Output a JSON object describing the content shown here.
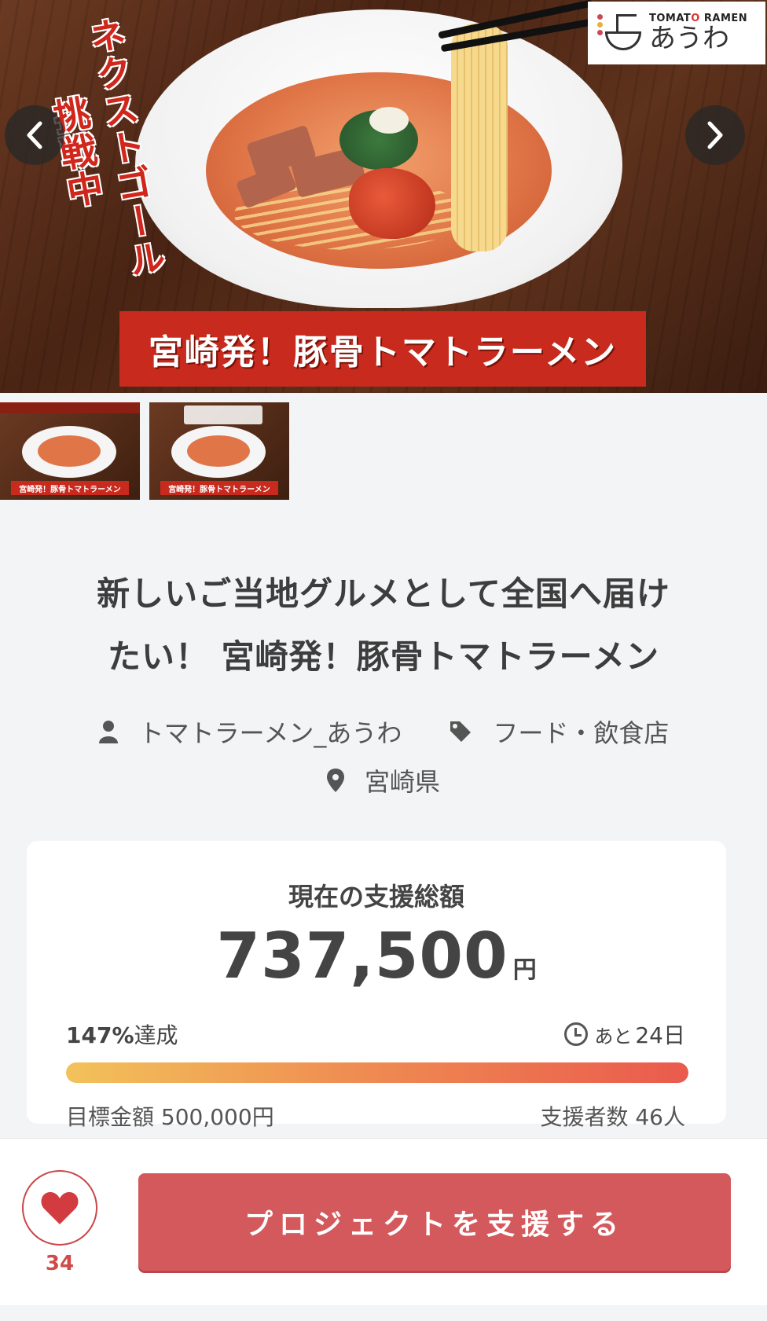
{
  "hero": {
    "vertical_text_1": "ネクストゴール",
    "vertical_text_2": "挑戦中",
    "banner_text": "宮崎発！豚骨トマトラーメン",
    "logo_en_prefix": "TOMAT",
    "logo_en_o": "O",
    "logo_en_suffix": " RAMEN",
    "logo_jp": "あうわ",
    "prev_icon": "chevron-left-icon",
    "next_icon": "chevron-right-icon"
  },
  "thumbnails": [
    {
      "banner": "宮崎発！豚骨トマトラーメン"
    },
    {
      "banner": "宮崎発！豚骨トマトラーメン"
    }
  ],
  "project": {
    "title_line1": "新しいご当地グルメとして全国へ届け",
    "title_line2": "たい！ 宮崎発！豚骨トマトラーメン",
    "owner": "トマトラーメン_あうわ",
    "category": "フード・飲食店",
    "location": "宮崎県"
  },
  "funding": {
    "label": "現在の支援総額",
    "amount": "737,500",
    "unit": "円",
    "achievement_percent": "147%",
    "achievement_suffix": "達成",
    "progress_fraction": 1.0,
    "remaining_prefix": "あと",
    "remaining_days": "24日",
    "goal_label": "目標金額 500,000円",
    "backers_label": "支援者数 46人"
  },
  "actions": {
    "like_count": "34",
    "support_button": "プロジェクトを支援する"
  },
  "colors": {
    "accent": "#d4595d",
    "heart": "#d23b3f",
    "progress_start": "#f2c25a",
    "progress_end": "#ea5a4d"
  }
}
